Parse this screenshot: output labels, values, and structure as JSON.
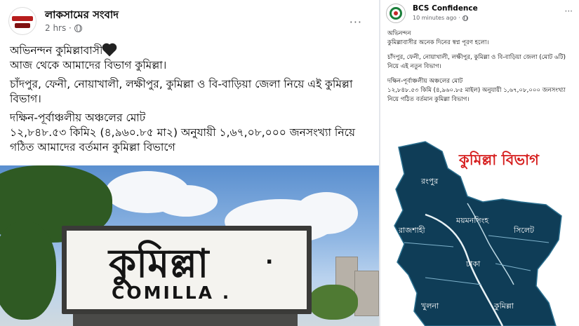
{
  "left_post": {
    "page_name": "লাকসামের সংবাদ",
    "time": "2 hrs ·",
    "more_menu": "···",
    "lines": [
      "অভিনন্দন কুমিল্লাবাসী",
      "আজ থেকে আমাদের বিভাগ কুমিল্লা।",
      "চাঁদপুর, ফেনী, নোয়াখালী, লক্ষীপুর, কুমিল্লা ও বি-বাড়িয়া জেলা নিয়ে এই কুমিল্লা বিভাগ।",
      "দক্ষিন-পূর্বাঞ্চলীয় অঞ্চলের মোট",
      "১২,৮৪৮.৫৩ কিমি২ (৪,৯৬০.৮৫ মা২) অনুযায়ী ১,৬৭,০৮,০০০ জনসংখ্যা নিয়ে গঠিত আমাদের বর্তমান কুমিল্লা বিভাগে"
    ],
    "photo_sign": {
      "bangla": "কুমিল্লা",
      "dot": ".",
      "latin": "COMILLA ."
    }
  },
  "right_post": {
    "page_name": "BCS Confidence",
    "time": "10 minutes ago ·",
    "more_menu": "···",
    "lines": [
      "অভিনন্দন",
      "কুমিল্লাবাসীর অনেক দিনের স্বপ্ন পূরণ হলো।",
      "চাঁদপুর, ফেনী, নোয়াখালী, লক্ষীপুর, কুমিল্লা ও বি-বাড়িয়া জেলা (মোট ৬টি) নিয়ে এই নতুন বিভাগ।",
      "দক্ষিন-পূর্বাঞ্চলীয় অঞ্চলের মোট",
      "১২,৮৪৮.৫৩ কিমি (৪,৯৬০.৮৫ মাইল) অনুযায়ী ১,৬৭,০৮,০০০ জনসংখ্যা নিয়ে গঠিত বর্তমান কুমিল্লা বিভাগ।"
    ],
    "map": {
      "title": "কুমিল্লা বিভাগ",
      "labels": {
        "rangpur": "রংপুর",
        "mymensingh": "ময়মনসিংহ",
        "rajshahi": "রাজশাহী",
        "sylhet": "সিলেট",
        "dhaka": "ঢাকা",
        "khulna": "খুলনা",
        "cumilla": "কুমিল্লা"
      }
    }
  },
  "colors": {
    "map_fill": "#0f3d57",
    "map_title": "#d61f1f",
    "meta_text": "#65676b"
  }
}
